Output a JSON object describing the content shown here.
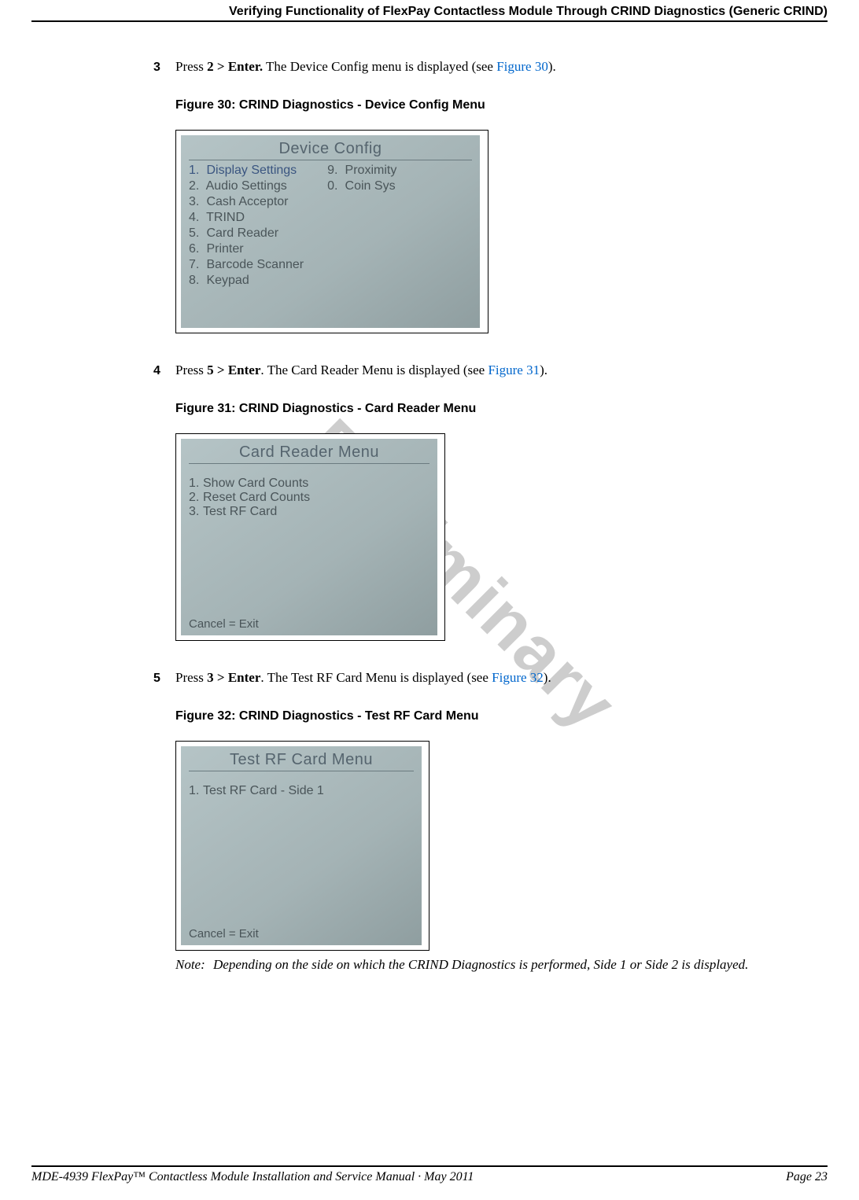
{
  "header": {
    "title": "Verifying Functionality of FlexPay Contactless Module Through CRIND Diagnostics (Generic CRIND)"
  },
  "watermark": "Preliminary",
  "steps": [
    {
      "num": "3",
      "text_pre": "Press ",
      "text_bold": "2 > Enter.",
      "text_mid": " The Device Config menu is displayed (see ",
      "link": "Figure 30",
      "text_post": ")."
    },
    {
      "num": "4",
      "text_pre": "Press ",
      "text_bold": "5 > Enter",
      "text_mid": ". The Card Reader Menu is displayed (see ",
      "link": "Figure 31",
      "text_post": ")."
    },
    {
      "num": "5",
      "text_pre": "Press ",
      "text_bold": "3 > Enter",
      "text_mid": ". The Test RF Card Menu is displayed (see ",
      "link": "Figure 32",
      "text_post": ")."
    }
  ],
  "figures": {
    "fig30": {
      "caption": "Figure 30: CRIND Diagnostics - Device Config Menu",
      "screen_title": "Device Config",
      "col1": [
        {
          "n": "1.",
          "label": "Display Settings"
        },
        {
          "n": "2.",
          "label": "Audio Settings"
        },
        {
          "n": "3.",
          "label": "Cash Acceptor"
        },
        {
          "n": "4.",
          "label": "TRIND"
        },
        {
          "n": "5.",
          "label": "Card Reader"
        },
        {
          "n": "6.",
          "label": "Printer"
        },
        {
          "n": "7.",
          "label": "Barcode Scanner"
        },
        {
          "n": "8.",
          "label": "Keypad"
        }
      ],
      "col2": [
        {
          "n": "9.",
          "label": "Proximity"
        },
        {
          "n": "0.",
          "label": "Coin Sys"
        }
      ]
    },
    "fig31": {
      "caption": "Figure 31: CRIND Diagnostics - Card Reader Menu",
      "screen_title": "Card Reader Menu",
      "items": [
        {
          "n": "1.",
          "label": "Show Card Counts"
        },
        {
          "n": "2.",
          "label": "Reset Card Counts"
        },
        {
          "n": "3.",
          "label": "Test RF Card"
        }
      ],
      "footer": "Cancel = Exit"
    },
    "fig32": {
      "caption": "Figure 32: CRIND Diagnostics - Test RF Card Menu",
      "screen_title": "Test RF Card Menu",
      "items": [
        {
          "n": "1.",
          "label": "Test RF Card - Side 1"
        }
      ],
      "footer": "Cancel = Exit"
    }
  },
  "note": {
    "label": "Note:",
    "body": "Depending on the side on which the CRIND Diagnostics is performed, Side 1 or Side 2 is displayed."
  },
  "footer": {
    "left": "MDE-4939 FlexPay™ Contactless Module Installation and Service Manual · May 2011",
    "right": "Page 23"
  }
}
